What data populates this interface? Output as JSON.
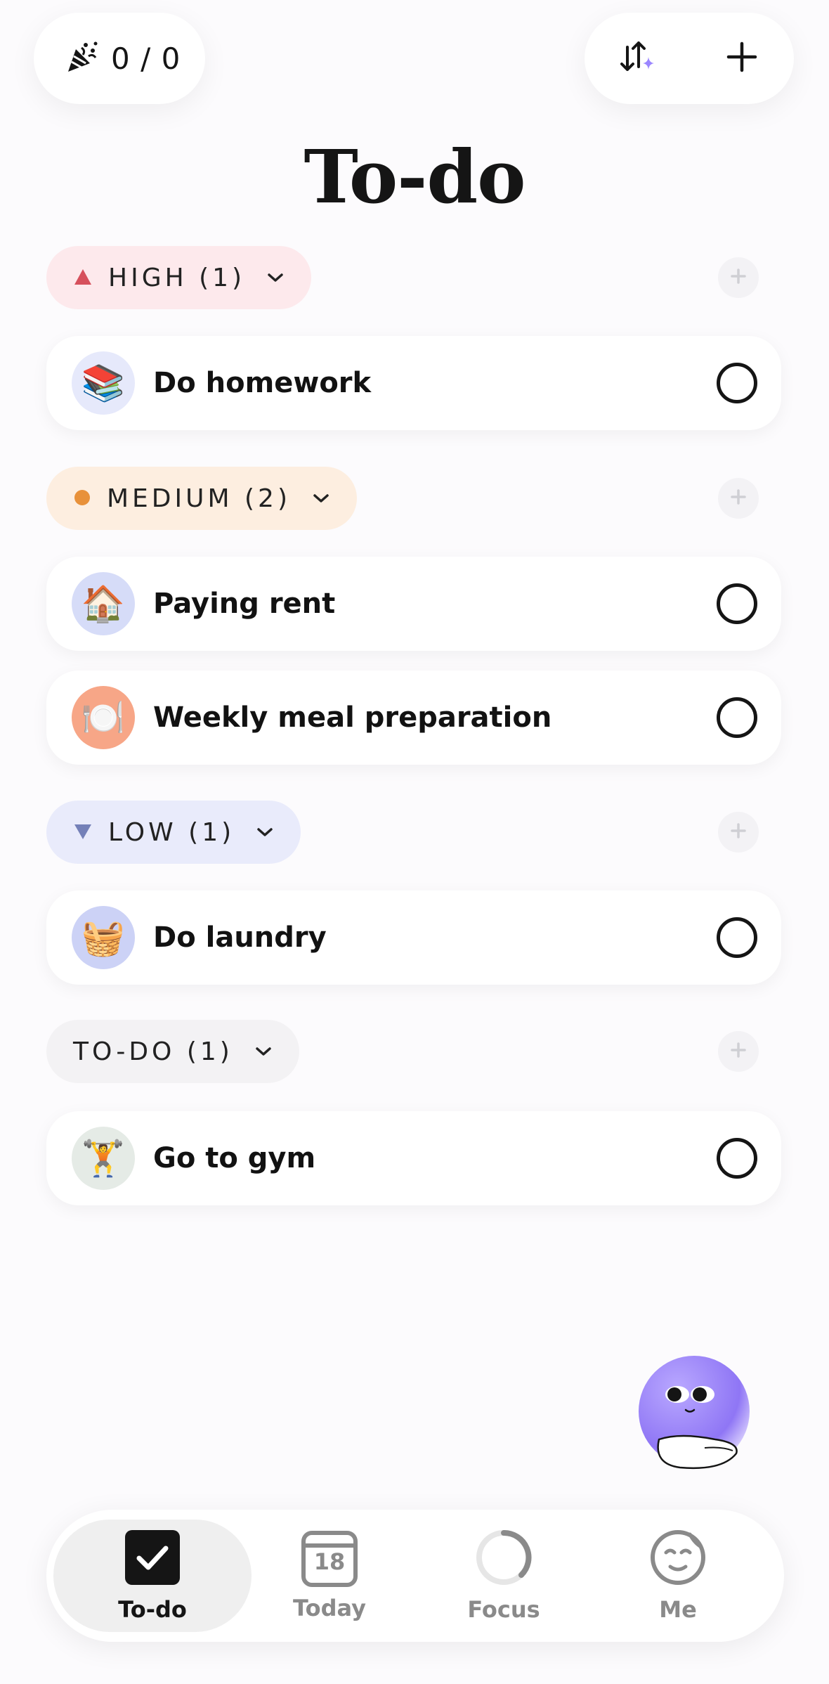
{
  "header": {
    "score": "0 / 0",
    "icons": {
      "score": "party-popper-icon",
      "sort": "ai-sort-icon",
      "add": "plus-icon"
    }
  },
  "page_title": "To-do",
  "sections": [
    {
      "key": "high",
      "label": "HIGH (1)",
      "bg": "#fde9ec",
      "marker_color": "#d6505c",
      "marker": "triangle-up",
      "tasks": [
        {
          "title": "Do homework",
          "emoji": "📚",
          "icon_bg": "#e6e9fb",
          "icon": "books-icon"
        }
      ]
    },
    {
      "key": "medium",
      "label": "MEDIUM (2)",
      "bg": "#fdeee0",
      "marker_color": "#e8913a",
      "marker": "dot",
      "tasks": [
        {
          "title": "Paying rent",
          "emoji": "🏠",
          "icon_bg": "#d6dcf8",
          "icon": "house-icon"
        },
        {
          "title": "Weekly meal preparation",
          "emoji": "🍽️",
          "icon_bg": "#f7a687",
          "icon": "plate-icon"
        }
      ]
    },
    {
      "key": "low",
      "label": "LOW (1)",
      "bg": "#e9ebfb",
      "marker_color": "#7480b8",
      "marker": "triangle-down",
      "tasks": [
        {
          "title": "Do laundry",
          "emoji": "🧺",
          "icon_bg": "#ccd2f6",
          "icon": "laundry-basket-icon"
        }
      ]
    },
    {
      "key": "todo",
      "label": "TO-DO (1)",
      "bg": "#f3f2f4",
      "marker_color": "",
      "marker": "none",
      "tasks": [
        {
          "title": "Go to gym",
          "emoji": "🏋️",
          "icon_bg": "#e5ebe6",
          "icon": "weightlifter-icon"
        }
      ]
    }
  ],
  "tabs": [
    {
      "label": "To-do",
      "icon": "checkbox-icon",
      "active": true
    },
    {
      "label": "Today",
      "icon": "calendar-icon",
      "calendar_day": "18",
      "active": false
    },
    {
      "label": "Focus",
      "icon": "focus-ring-icon",
      "active": false
    },
    {
      "label": "Me",
      "icon": "face-icon",
      "active": false
    }
  ],
  "colors": {
    "accent": "#9b86ff",
    "text": "#151515",
    "muted": "#8a8a8a"
  }
}
